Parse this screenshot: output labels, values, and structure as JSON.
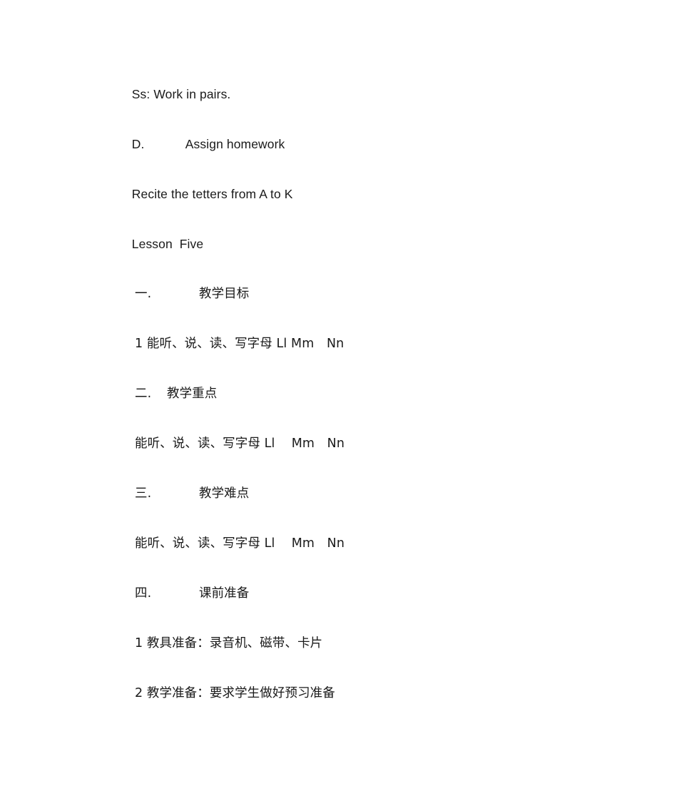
{
  "document": {
    "background_color": "#ffffff",
    "text_color": "#1a1a1a",
    "paragraphs": [
      {
        "id": "ss-work-in-pairs",
        "name": "paragraph-ss-work-in-pairs",
        "text": "Ss: Work in pairs."
      },
      {
        "id": "assign-homework",
        "name": "paragraph-assign-homework",
        "marker": "D.",
        "text": "Assign homework"
      },
      {
        "id": "recite-letters",
        "name": "paragraph-recite-letters",
        "text": "Recite the tetters from A to K"
      },
      {
        "id": "lesson-title",
        "name": "paragraph-lesson-title",
        "text": "Lesson  Five"
      },
      {
        "id": "heading-teaching-objectives",
        "name": "heading-teaching-objectives",
        "marker": "一.",
        "text": "教学目标"
      },
      {
        "id": "objective-item-1",
        "name": "paragraph-objective-item-1",
        "text": "1 能听、说、读、写字母 Ll Mm　Nn"
      },
      {
        "id": "heading-teaching-focus",
        "name": "heading-teaching-focus",
        "marker": "二.",
        "text": "教学重点"
      },
      {
        "id": "focus-detail",
        "name": "paragraph-focus-detail",
        "text": "能听、说、读、写字母 Ll 　Mm　Nn"
      },
      {
        "id": "heading-teaching-difficulty",
        "name": "heading-teaching-difficulty",
        "marker": "三.",
        "text": "教学难点"
      },
      {
        "id": "difficulty-detail",
        "name": "paragraph-difficulty-detail",
        "text": "能听、说、读、写字母 Ll 　Mm　Nn"
      },
      {
        "id": "heading-pre-class-preparation",
        "name": "heading-pre-class-preparation",
        "marker": "四.",
        "text": "课前准备"
      },
      {
        "id": "preparation-item-1",
        "name": "paragraph-preparation-item-1",
        "text": "1 教具准备：录音机、磁带、卡片"
      },
      {
        "id": "preparation-item-2",
        "name": "paragraph-preparation-item-2",
        "text": "2 教学准备：要求学生做好预习准备"
      }
    ]
  }
}
